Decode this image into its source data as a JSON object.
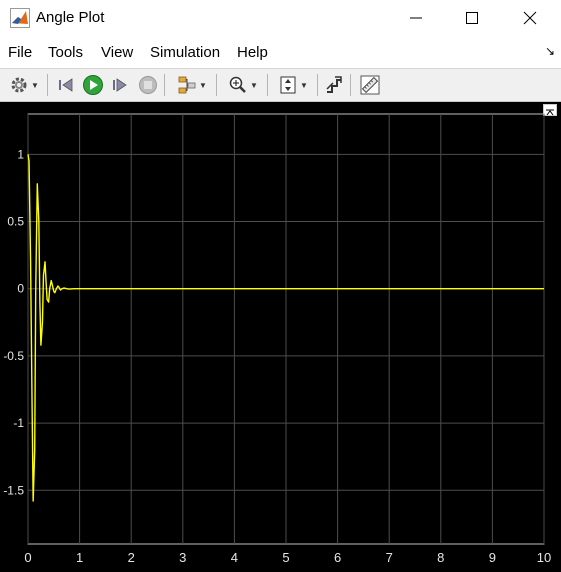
{
  "window": {
    "title": "Angle Plot",
    "controls": {
      "minimize": "─",
      "maximize": "☐",
      "close": "✕"
    }
  },
  "menu": {
    "items": [
      {
        "label": "File",
        "id": "file"
      },
      {
        "label": "Tools",
        "id": "tools"
      },
      {
        "label": "View",
        "id": "view"
      },
      {
        "label": "Simulation",
        "id": "simulation"
      },
      {
        "label": "Help",
        "id": "help"
      }
    ],
    "dock_symbol": "↘"
  },
  "toolbar": {
    "buttons": [
      "settings",
      "step-back",
      "run",
      "step-forward",
      "stop",
      "highlight-signal",
      "zoom",
      "autoscale",
      "style",
      "measurements"
    ]
  },
  "colors": {
    "plot_background": "#000000",
    "grid": "#4d4d4d",
    "axes": "#c0c0c0",
    "signal": "#ffff00",
    "run_green": "#2ea43a"
  },
  "chart_data": {
    "type": "line",
    "title": "",
    "xlabel": "",
    "ylabel": "",
    "xlim": [
      0,
      10
    ],
    "ylim": [
      -1.9,
      1.3
    ],
    "xticks": [
      0,
      1,
      2,
      3,
      4,
      5,
      6,
      7,
      8,
      9,
      10
    ],
    "yticks": [
      1,
      0.5,
      0,
      -0.5,
      -1,
      -1.5
    ],
    "xtick_labels": [
      "0",
      "1",
      "2",
      "3",
      "4",
      "5",
      "6",
      "7",
      "8",
      "9",
      "10"
    ],
    "ytick_labels": [
      "1",
      "0.5",
      "0",
      "-0.5",
      "-1",
      "-1.5"
    ],
    "grid": true,
    "series": [
      {
        "x": [
          0,
          0.02,
          0.05,
          0.08,
          0.1,
          0.13,
          0.15,
          0.18,
          0.21,
          0.23,
          0.25,
          0.28,
          0.3,
          0.33,
          0.35,
          0.37,
          0.4,
          0.42,
          0.45,
          0.47,
          0.5,
          0.52,
          0.55,
          0.58,
          0.6,
          0.63,
          0.66,
          0.7,
          0.75,
          0.8,
          0.9,
          1.0,
          1.2,
          1.5,
          2,
          3,
          4,
          5,
          6,
          7,
          8,
          9,
          10
        ],
        "y": [
          1.0,
          0.95,
          0.2,
          -0.9,
          -1.58,
          -1.2,
          0.0,
          0.78,
          0.5,
          -0.1,
          -0.42,
          -0.25,
          0.1,
          0.2,
          0.05,
          -0.08,
          -0.1,
          0.0,
          0.06,
          0.03,
          -0.02,
          -0.03,
          0.0,
          0.02,
          0.01,
          -0.01,
          0.0,
          0.005,
          0.0,
          -0.003,
          0.0,
          0.0,
          0.0,
          0.0,
          0.0,
          0.0,
          0.0,
          0.0,
          0.0,
          0.0,
          0.0,
          0.0,
          0.0
        ]
      }
    ]
  }
}
